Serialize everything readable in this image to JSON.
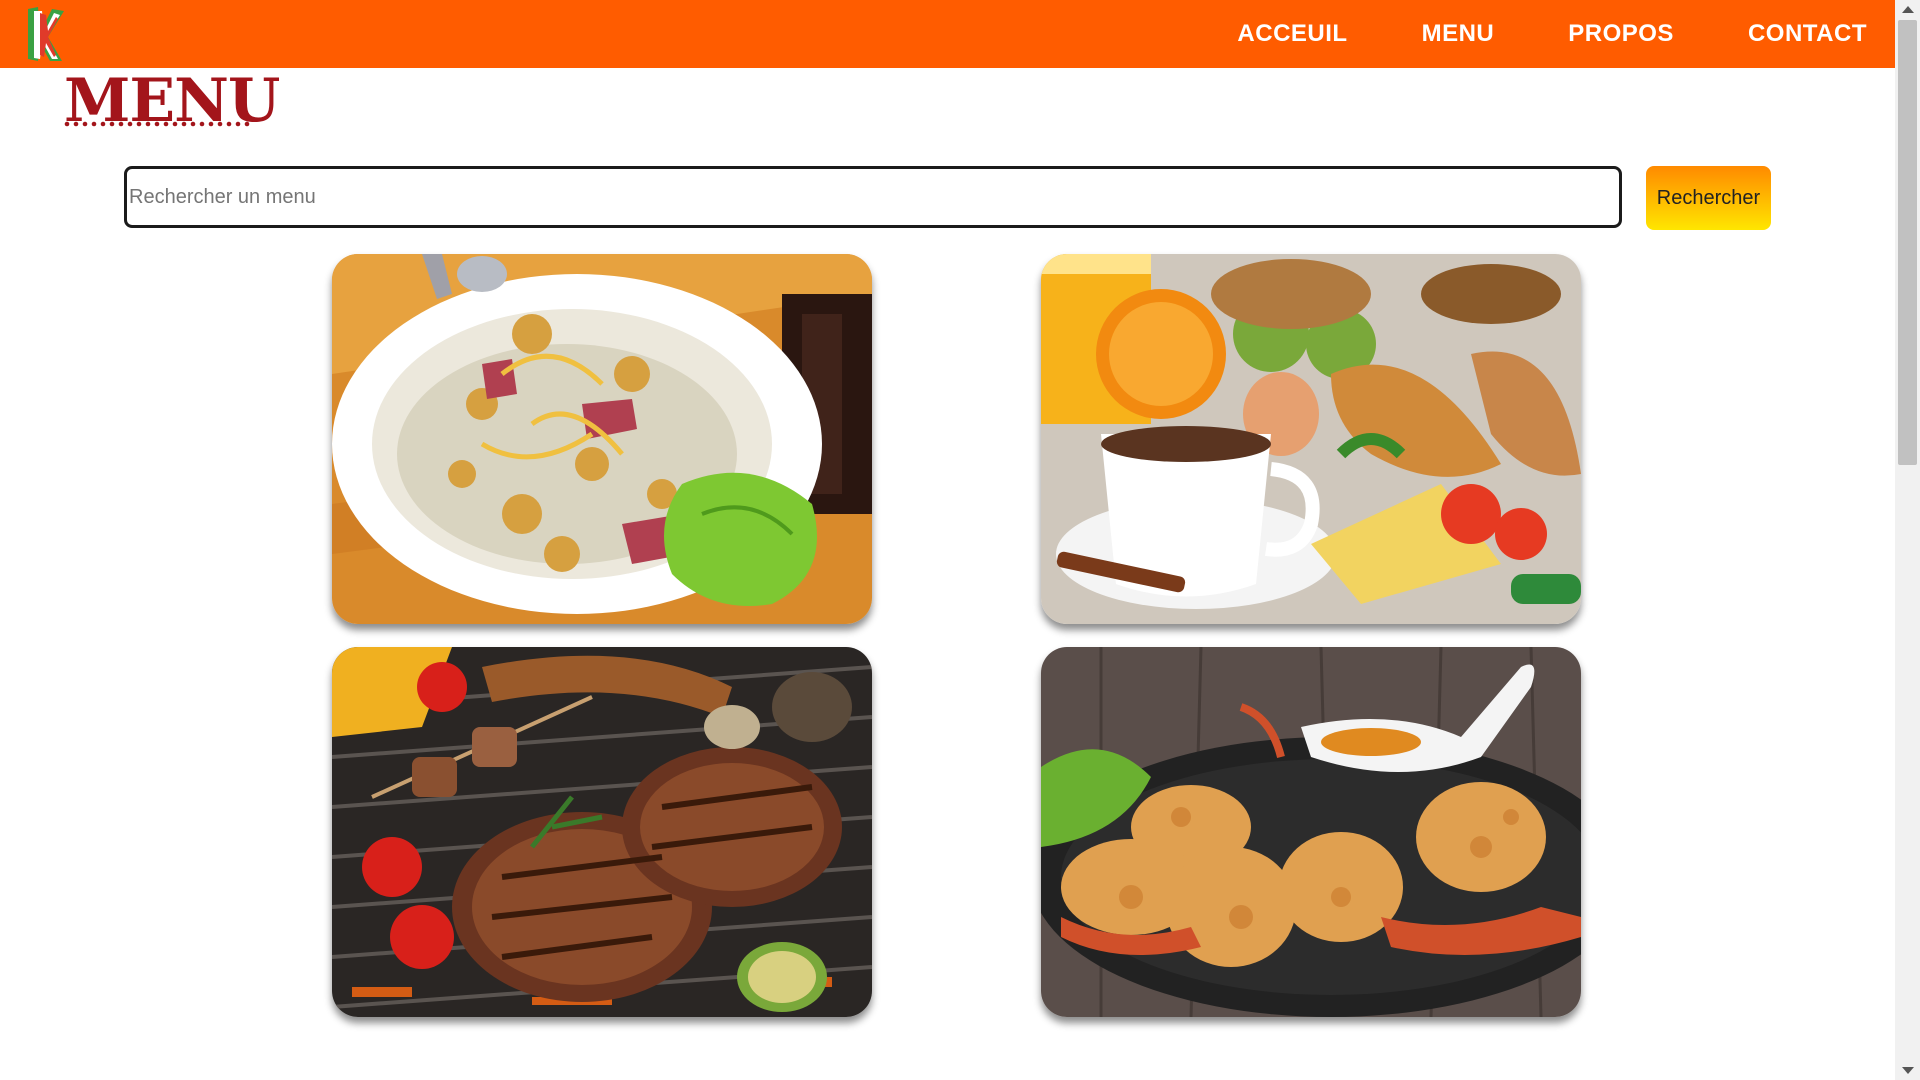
{
  "colors": {
    "navbar": "#ff5c00",
    "title": "#a3151b",
    "button_top": "#ff8a00",
    "button_bottom": "#ffe600"
  },
  "logo": {
    "icon": "restaurant-logo-icon"
  },
  "nav": {
    "items": [
      {
        "label": "ACCEUIL"
      },
      {
        "label": "MENU"
      },
      {
        "label": "PROPOS"
      },
      {
        "label": "CONTACT"
      }
    ]
  },
  "page": {
    "title": "MENU"
  },
  "search": {
    "value": "",
    "placeholder": "Rechercher un menu",
    "button_label": "Rechercher"
  },
  "menu": {
    "items": [
      {
        "image": "noodle-soup-image"
      },
      {
        "image": "breakfast-image"
      },
      {
        "image": "grilled-meat-image"
      },
      {
        "image": "fried-shrimp-image"
      }
    ]
  }
}
